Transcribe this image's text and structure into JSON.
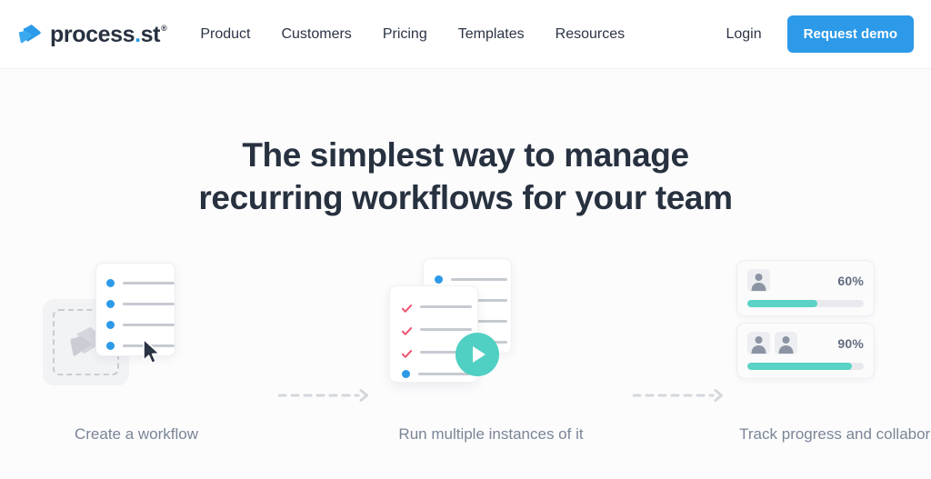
{
  "header": {
    "brand": {
      "name_part1": "process",
      "dot": ".",
      "name_part2": "st",
      "registered": "®",
      "logo_icon": "process-st-logo-icon"
    },
    "nav": [
      {
        "label": "Product"
      },
      {
        "label": "Customers"
      },
      {
        "label": "Pricing"
      },
      {
        "label": "Templates"
      },
      {
        "label": "Resources"
      }
    ],
    "login_label": "Login",
    "demo_label": "Request demo"
  },
  "hero": {
    "headline": "The simplest way to manage\nrecurring workflows for your team",
    "steps": [
      {
        "caption": "Create a workflow",
        "list_lines": 4
      },
      {
        "caption": "Run multiple instances of it",
        "play_icon": "play-icon"
      },
      {
        "caption": "Track progress and collaborate",
        "progress_cards": [
          {
            "percent_label": "60%",
            "percent_value": 60,
            "avatars": 1
          },
          {
            "percent_label": "90%",
            "percent_value": 90,
            "avatars": 2
          }
        ]
      }
    ],
    "connector_icon": "dashed-arrow-right-icon"
  },
  "colors": {
    "brand_blue": "#2c9ae8",
    "teal": "#50cfc3",
    "ink": "#27313f",
    "muted": "#7a8596",
    "line_gray": "#c6cad1",
    "check_red": "#f0556f",
    "hero_bg": "#fcfcfd"
  }
}
